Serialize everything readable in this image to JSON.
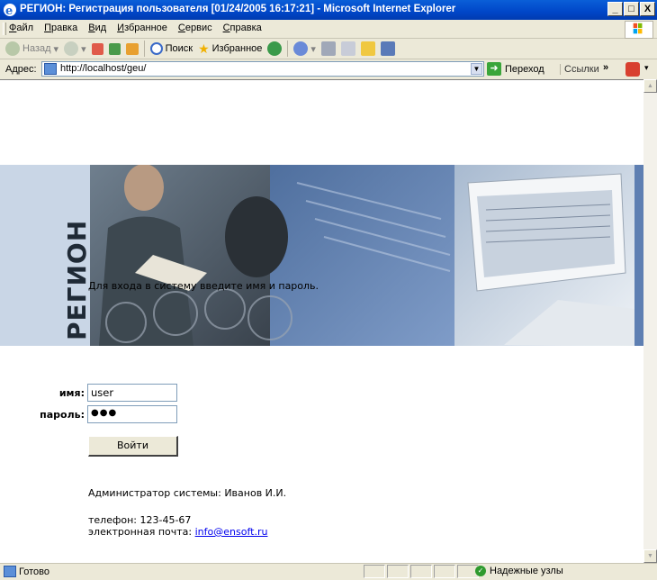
{
  "window": {
    "title": "РЕГИОН: Регистрация пользователя [01/24/2005 16:17:21] - Microsoft Internet Explorer",
    "minimize": "_",
    "maximize": "□",
    "close": "X"
  },
  "menu": [
    "Файл",
    "Правка",
    "Вид",
    "Избранное",
    "Сервис",
    "Справка"
  ],
  "toolbar": {
    "back": "Назад",
    "search": "Поиск",
    "favorites": "Избранное"
  },
  "address": {
    "label": "Адрес:",
    "url": "http://localhost/geu/",
    "go": "Переход",
    "links": "Ссылки"
  },
  "banner": {
    "brand": "РЕГИОН",
    "colors": {
      "left": "#c9d6e6",
      "middle": "#5e7fb2",
      "right": "#dfe7f0"
    }
  },
  "login": {
    "prompt": "Для входа в систему введите имя и пароль.",
    "name_label": "имя:",
    "name_value": "user",
    "password_label": "пароль:",
    "password_value": "●●●",
    "submit": "Войти"
  },
  "footer": {
    "admin": "Администратор системы: Иванов И.И.",
    "phone": "телефон: 123-45-67",
    "email_label": "электронная почта:",
    "email": "info@ensoft.ru"
  },
  "status": {
    "text": "Готово",
    "zone": "Надежные узлы"
  }
}
